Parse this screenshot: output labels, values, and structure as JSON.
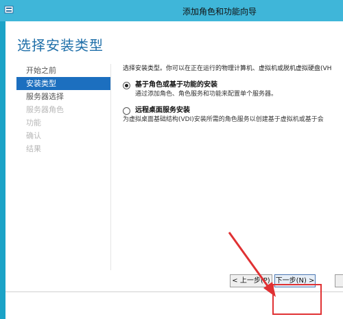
{
  "window": {
    "title": "添加角色和功能向导"
  },
  "page": {
    "title": "选择安装类型"
  },
  "nav": {
    "items": [
      {
        "label": "开始之前",
        "state": "normal"
      },
      {
        "label": "安装类型",
        "state": "active"
      },
      {
        "label": "服务器选择",
        "state": "normal"
      },
      {
        "label": "服务器角色",
        "state": "disabled"
      },
      {
        "label": "功能",
        "state": "disabled"
      },
      {
        "label": "确认",
        "state": "disabled"
      },
      {
        "label": "结果",
        "state": "disabled"
      }
    ]
  },
  "content": {
    "intro": "选择安装类型。你可以在正在运行的物理计算机、虚拟机或脱机虚拟硬盘(VH",
    "options": [
      {
        "title": "基于角色或基于功能的安装",
        "desc": "通过添加角色、角色服务和功能来配置单个服务器。",
        "checked": true
      },
      {
        "title": "远程桌面服务安装",
        "desc": "为虚拟桌面基础结构(VDI)安装所需的角色服务以创建基于虚拟机或基于会",
        "checked": false
      }
    ]
  },
  "buttons": {
    "prev": "< 上一步(P)",
    "next": "下一步(N) >"
  },
  "colors": {
    "accent": "#1c6fbf",
    "titlebar": "#3fb6d9",
    "annotation": "#e03133"
  }
}
